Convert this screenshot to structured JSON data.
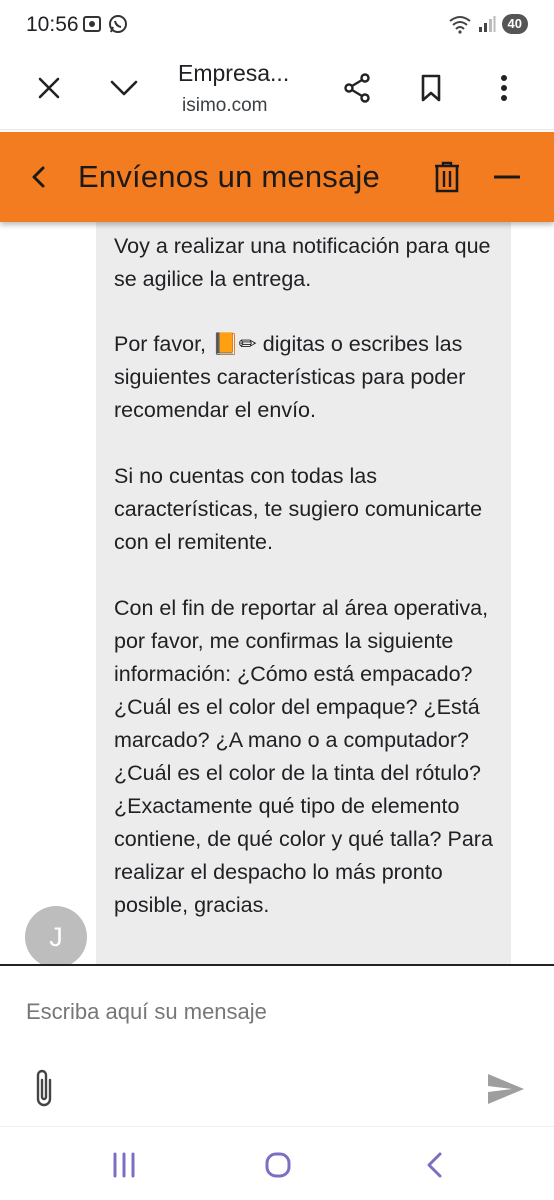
{
  "status_bar": {
    "time": "10:56",
    "battery": "40",
    "icons": [
      "screenshot-icon",
      "whatsapp-icon",
      "wifi-icon",
      "signal-icon"
    ]
  },
  "browser": {
    "title": "Empresa...",
    "url": "isimo.com"
  },
  "chat": {
    "title": "Envíenos un mensaje",
    "avatar_letter": "J",
    "messages": [
      "Voy a realizar una notificación para que se agilice la entrega.",
      "Por favor, 📙✏ digitas o escribes las siguientes características para poder recomendar el envío.",
      "Si no cuentas con todas las características, te sugiero comunicarte con el remitente.",
      "Con el fin de reportar al área operativa, por favor, me confirmas la siguiente información: ¿Cómo está empacado? ¿Cuál es el color del empaque? ¿Está marcado? ¿A mano o a computador? ¿Cuál es el color de la tinta del rótulo? ¿Exactamente qué tipo de elemento contiene, de qué color y qué talla? Para realizar el despacho lo más pronto posible, gracias."
    ]
  },
  "composer": {
    "placeholder": "Escriba aquí su mensaje"
  },
  "colors": {
    "accent": "#f47c20",
    "bubble": "#ececec",
    "avatar": "#bdbdbd",
    "nav_icons": "#7b6fc4",
    "send_icon": "#9e9e9e"
  }
}
